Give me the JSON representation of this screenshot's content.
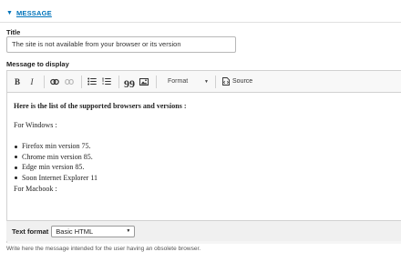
{
  "section": {
    "toggle_label": "MESSAGE"
  },
  "title_field": {
    "label": "Title",
    "value": "The site is not available from your browser or its version"
  },
  "message_field": {
    "label": "Message to display"
  },
  "toolbar": {
    "bold": "B",
    "italic": "I",
    "blockquote": "99",
    "format_label": "Format",
    "source_label": "Source"
  },
  "content": {
    "heading": "Here is the list of the supported browsers and versions :",
    "windows_label": "For Windows :",
    "list_items": [
      "Firefox min version 75.",
      "Chrome min version 85.",
      "Edge min version 85.",
      "Soon Internet Explorer 11"
    ],
    "macbook_label": "For Macbook :"
  },
  "text_format": {
    "label": "Text format",
    "selected": "Basic HTML"
  },
  "help_text": "Write here the message intended for the user having an obsolete browser.",
  "colors": {
    "link": "#0073ba",
    "toolbar_bg": "#f8f8f8",
    "format_row_bg": "#f0f0f0"
  }
}
